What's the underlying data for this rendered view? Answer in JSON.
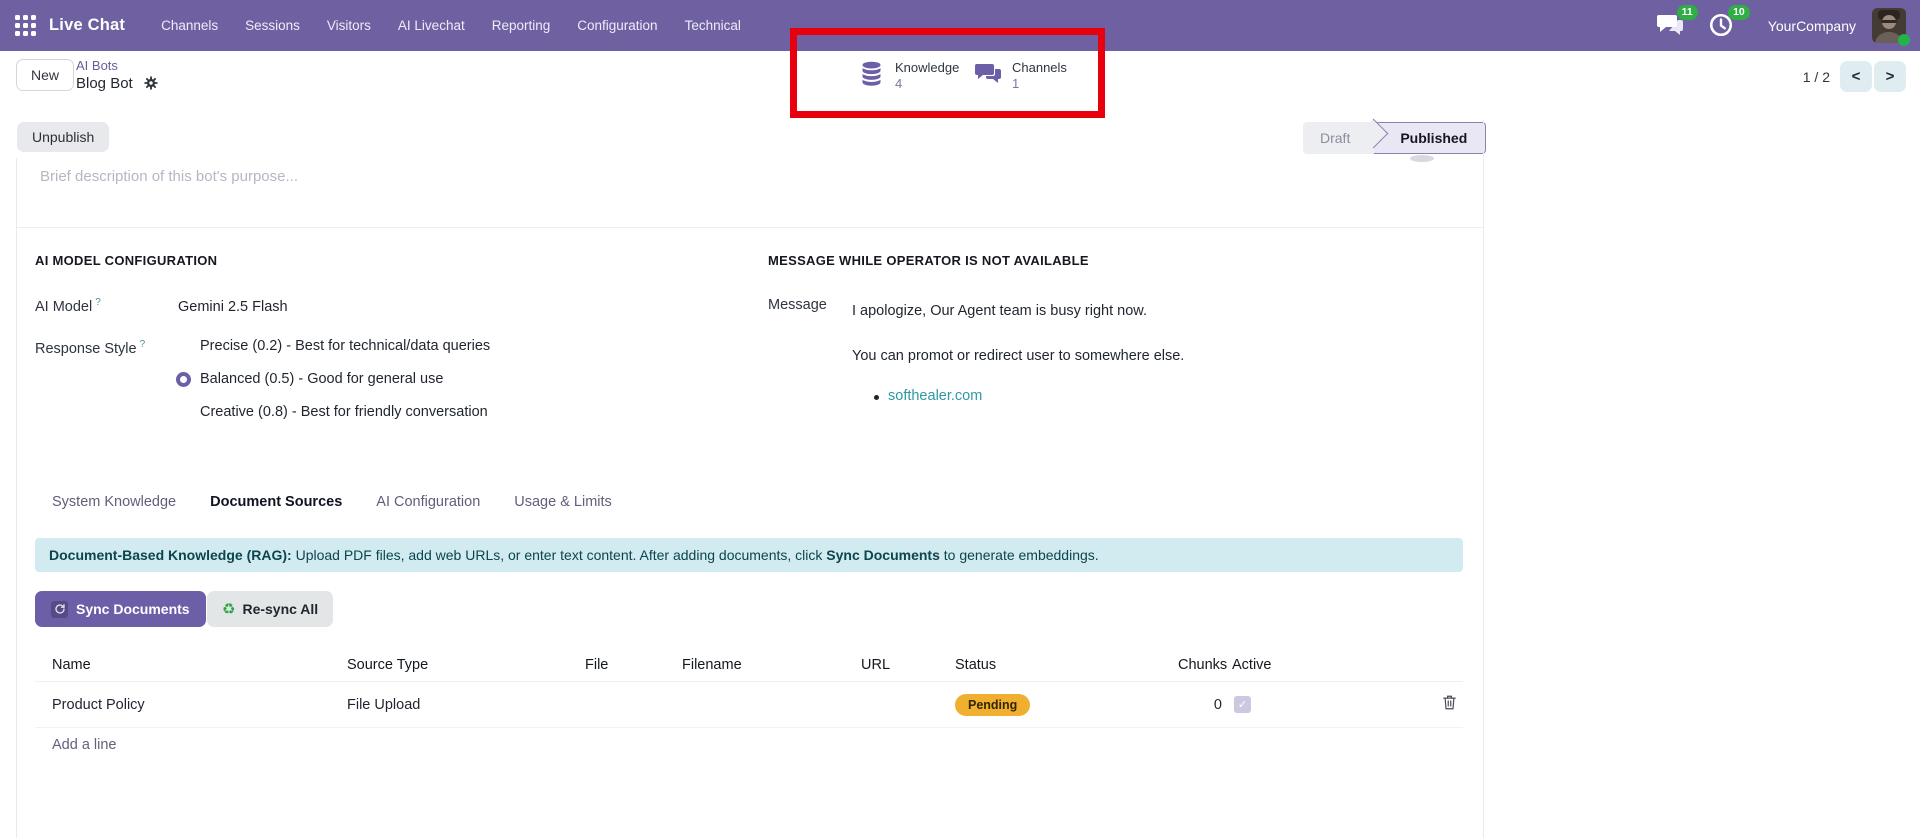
{
  "nav": {
    "brand": "Live Chat",
    "items": [
      "Channels",
      "Sessions",
      "Visitors",
      "AI Livechat",
      "Reporting",
      "Configuration",
      "Technical"
    ],
    "messages_badge": "11",
    "activities_badge": "10",
    "company": "YourCompany"
  },
  "breadcrumb": {
    "new_button": "New",
    "parent": "AI Bots",
    "current": "Blog Bot"
  },
  "stats": [
    {
      "icon": "database-icon",
      "label": "Knowledge",
      "value": "4"
    },
    {
      "icon": "chat-bubbles-icon",
      "label": "Channels",
      "value": "1"
    }
  ],
  "pager": {
    "text": "1 / 2",
    "prev": "<",
    "next": ">"
  },
  "status_row": {
    "unpublish": "Unpublish",
    "draft": "Draft",
    "published": "Published"
  },
  "form": {
    "description_placeholder": "Brief description of this bot's purpose...",
    "help_mark": "?",
    "left": {
      "title": "AI MODEL CONFIGURATION",
      "ai_model_label": "AI Model",
      "ai_model_value": "Gemini 2.5 Flash",
      "response_style_label": "Response Style",
      "options": [
        {
          "label": "Precise (0.2) - Best for technical/data queries",
          "selected": false
        },
        {
          "label": "Balanced (0.5) - Good for general use",
          "selected": true
        },
        {
          "label": "Creative (0.8) - Best for friendly conversation",
          "selected": false
        }
      ]
    },
    "right": {
      "title": "MESSAGE WHILE OPERATOR IS NOT AVAILABLE",
      "message_label": "Message",
      "line1": "I apologize, Our Agent team is busy right now.",
      "line2": "You can promot or redirect user to somewhere else.",
      "link": "softhealer.com"
    }
  },
  "tabs": [
    {
      "label": "System Knowledge",
      "active": false
    },
    {
      "label": "Document Sources",
      "active": true
    },
    {
      "label": "AI Configuration",
      "active": false
    },
    {
      "label": "Usage & Limits",
      "active": false
    }
  ],
  "banner": {
    "bold1": "Document-Based Knowledge (RAG):",
    "text1": " Upload PDF files, add web URLs, or enter text content. After adding documents, click ",
    "bold2": "Sync Documents",
    "text2": " to generate embeddings."
  },
  "doc_buttons": {
    "sync": "Sync Documents",
    "resync": "Re-sync All"
  },
  "table": {
    "headers": [
      "Name",
      "Source Type",
      "File",
      "Filename",
      "URL",
      "Status",
      "Chunks",
      "Active"
    ],
    "rows": [
      {
        "name": "Product Policy",
        "source_type": "File Upload",
        "file": "",
        "filename": "",
        "url": "",
        "status": "Pending",
        "chunks": "0",
        "active": true
      }
    ],
    "add_line": "Add a line",
    "checkmark": "✓"
  },
  "colors": {
    "nav_purple": "#6F61A1",
    "accent_purple": "#6C5FA7",
    "badge_green": "#2FAE43",
    "pending_amber": "#F0AF2E",
    "info_banner_bg": "#D2EBF0",
    "info_banner_text": "#0B454E",
    "link_teal": "#2E98A3",
    "annotation_red": "#E9000E"
  }
}
